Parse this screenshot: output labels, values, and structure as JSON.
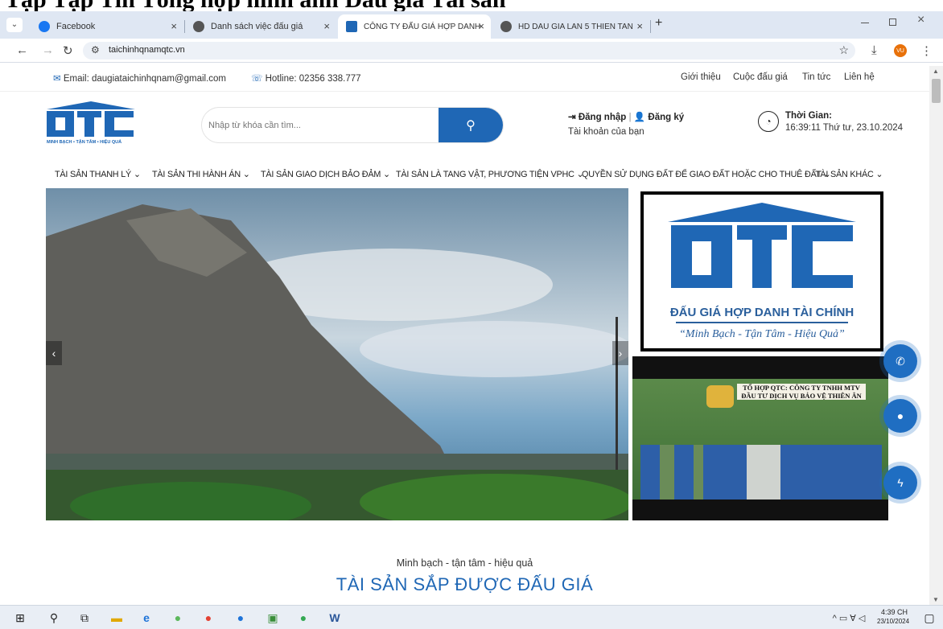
{
  "page_overlay": {
    "text": "Tập Tập Tin Tổng hợp hình ảnh Đấu giá Tài sản"
  },
  "browser": {
    "tabs": [
      {
        "label": "Facebook"
      },
      {
        "label": "Danh sách việc đấu giá"
      },
      {
        "label": "CÔNG TY ĐẤU GIÁ HỢP DANH"
      },
      {
        "label": "HD DAU GIA LAN 5 THIEN TAN"
      }
    ],
    "new_tab": "+",
    "close": "×",
    "url": "taichinhqnamqtc.vn",
    "profile": "VU"
  },
  "topbar": {
    "email_label": "Email: daugiataichinhqnam@gmail.com",
    "hotline_label": "Hotline: 02356 338.777",
    "links": [
      "Giới thiệu",
      "Cuộc đấu giá",
      "Tin tức",
      "Liên hệ"
    ]
  },
  "header": {
    "logo_letters": "OTC",
    "logo_slogan": "MINH BẠCH • TẬN TÂM • HIỆU QUẢ",
    "search_placeholder": "Nhập từ khóa cần tìm...",
    "login": "Đăng nhập",
    "register": "Đăng ký",
    "account_caption": "Tài khoản của bạn",
    "time_label": "Thời Gian:",
    "time_value": "16:39:11 Thứ tư, 23.10.2024"
  },
  "nav": {
    "items": [
      "TÀI SẢN THANH LÝ",
      "TÀI SẢN THI HÀNH ÁN",
      "TÀI SẢN GIAO DỊCH BẢO ĐẢM",
      "TÀI SẢN LÀ TANG VẬT, PHƯƠNG TIỆN VPHC",
      "QUYỀN SỬ DỤNG ĐẤT ĐỂ GIAO ĐẤT HOẶC CHO THUÊ ĐẤT",
      "TÀI SẢN KHÁC"
    ]
  },
  "slider": {
    "prev": "‹",
    "next": "›"
  },
  "side_banner": {
    "title": "ĐẤU GIÁ HỢP DANH TÀI CHÍNH",
    "motto": "“Minh Bạch - Tận Tâm - Hiệu Quả”"
  },
  "group_banner": {
    "text": "TỔ HỢP QTC: CÔNG TY TNHH MTV ĐẦU TƯ DỊCH VỤ BẢO VỆ THIÊN ÂN"
  },
  "main": {
    "tagline": "Minh bạch - tận tâm - hiệu quả",
    "section_title": "TÀI SẢN SẮP ĐƯỢC ĐẤU GIÁ"
  },
  "taskbar": {
    "time": "4:39 CH",
    "date": "23/10/2024"
  },
  "colors": {
    "brand_blue": "#1f67b5",
    "tab_bar": "#dfe7f3"
  }
}
